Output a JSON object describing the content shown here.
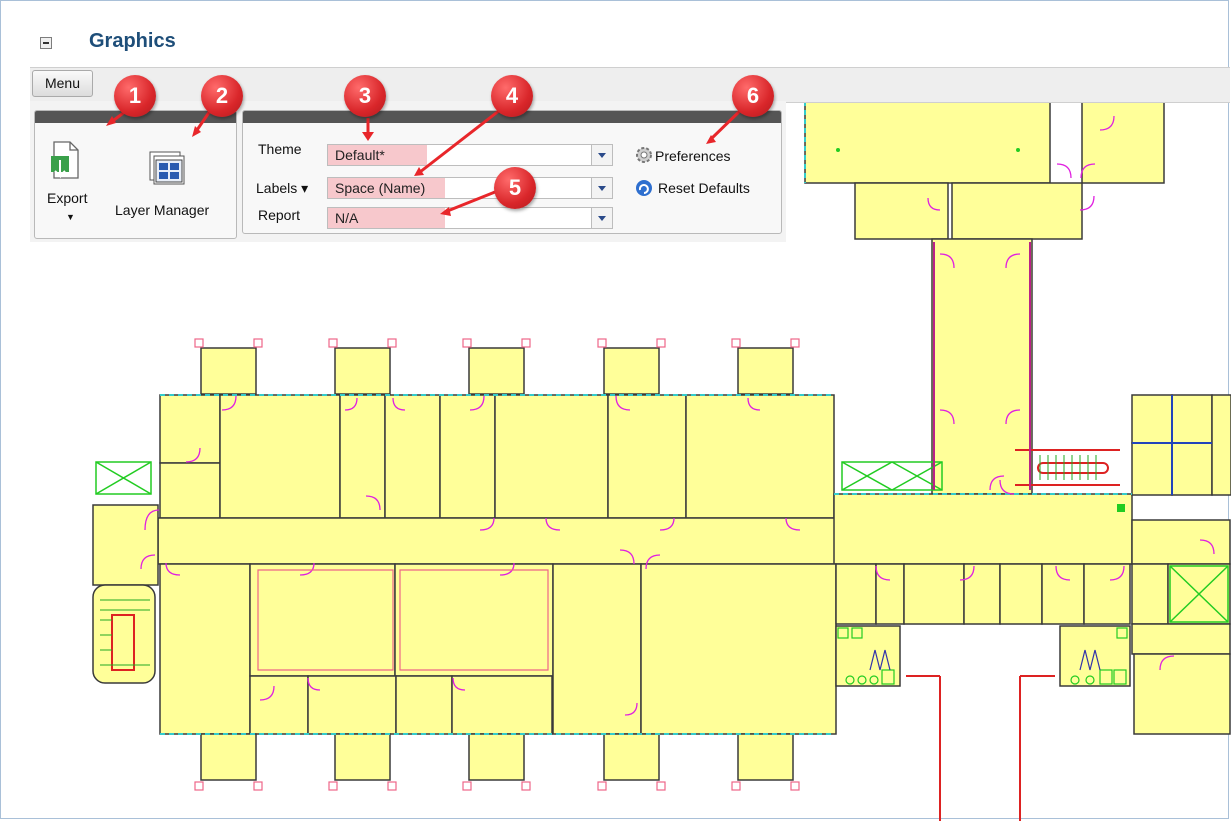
{
  "panel": {
    "title": "Graphics"
  },
  "toolbar": {
    "menu_label": "Menu"
  },
  "export_group": {
    "export_label": "Export",
    "layer_manager_label": "Layer Manager"
  },
  "settings_group": {
    "theme_label": "Theme",
    "theme_value": "Default*",
    "labels_label": "Labels ▾",
    "labels_value": "Space (Name)",
    "report_label": "Report",
    "report_value": "N/A",
    "preferences_label": "Preferences",
    "reset_label": "Reset Defaults"
  },
  "callouts": [
    "1",
    "2",
    "3",
    "4",
    "5",
    "6"
  ],
  "colors": {
    "room_fill": "#ffff99",
    "wall": "#3a3a3a",
    "door": "#e020e0",
    "window": "#33cccc",
    "fixture": "#22cc22",
    "stair": "#dd2222",
    "hdr_text": "#1e4e79",
    "badge": "#d9262a",
    "arrow": "#e8262a"
  },
  "icons": [
    "collapse-icon",
    "export-icon",
    "layer-manager-icon",
    "gear-icon",
    "reset-icon",
    "dropdown-arrow-icon"
  ]
}
